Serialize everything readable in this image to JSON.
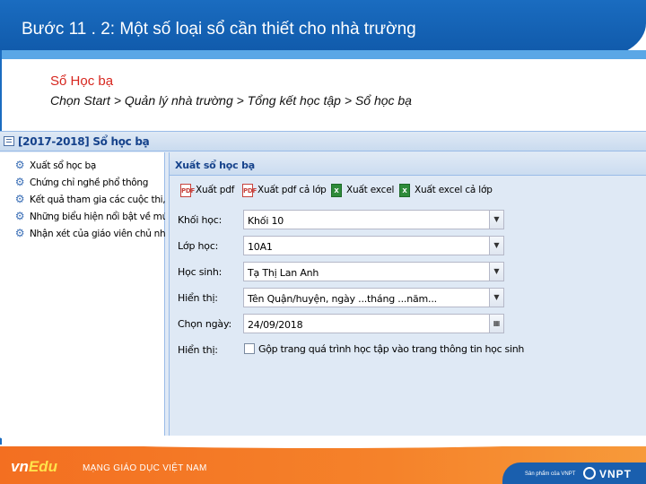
{
  "slide": {
    "title": "Bước 11 . 2: Một số loại sổ cần thiết cho nhà trường",
    "subtitle": "Sổ Học bạ",
    "instruction": "Chọn Start > Quản lý nhà trường > Tổng kết học tập > Sổ học bạ"
  },
  "app": {
    "window_title": "[2017-2018] Sổ học bạ",
    "menu": [
      {
        "label": "Xuất sổ học bạ",
        "icon": "gear-icon"
      },
      {
        "label": "Chứng chỉ nghề phổ thông",
        "icon": "gear-icon"
      },
      {
        "label": "Kết quả tham gia các cuộc thi, ...",
        "icon": "gear-icon"
      },
      {
        "label": "Những biểu hiện nổi bật về mứ...",
        "icon": "gear-icon"
      },
      {
        "label": "Nhận xét của giáo viên chủ nhi...",
        "icon": "gear-icon"
      }
    ],
    "panel_title": "Xuất sổ học bạ",
    "toolbar": [
      {
        "label": "Xuất pdf",
        "icon": "pdf-icon"
      },
      {
        "label": "Xuất pdf cả lớp",
        "icon": "pdf-icon"
      },
      {
        "label": "Xuất excel",
        "icon": "excel-icon"
      },
      {
        "label": "Xuất excel cả lớp",
        "icon": "excel-icon"
      }
    ],
    "form": {
      "grade": {
        "label": "Khối học:",
        "value": "Khối 10"
      },
      "class": {
        "label": "Lớp học:",
        "value": "10A1"
      },
      "student": {
        "label": "Học sinh:",
        "value": "Tạ Thị Lan Anh"
      },
      "display": {
        "label": "Hiển thị:",
        "value": "Tên Quận/huyện, ngày ...tháng ...năm..."
      },
      "date": {
        "label": "Chọn ngày:",
        "value": "24/09/2018"
      },
      "display2": {
        "label": "Hiển thị:",
        "checkbox_label": "Gộp trang quá trình học tập vào trang thông tin học sinh"
      }
    }
  },
  "footer": {
    "logo_vn": "vn",
    "logo_edu": "Edu",
    "tagline": "MẠNG GIÁO DỤC VIỆT NAM",
    "product_of": "Sản phẩm của VNPT",
    "brand": "VNPT"
  },
  "colors": {
    "header_blue": "#1a6cc0",
    "subtitle_red": "#d7261e",
    "footer_orange": "#f36f21",
    "panel_bg": "#dfe9f5",
    "panel_title": "#15428b"
  }
}
